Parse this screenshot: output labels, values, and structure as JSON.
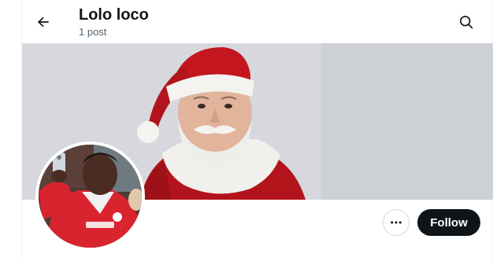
{
  "header": {
    "profile_name": "Lolo loco",
    "post_count": "1 post",
    "back_icon": "arrow-left-icon",
    "search_icon": "search-icon"
  },
  "profile": {
    "banner": "santa-claus-banner-photo",
    "avatar": "footballer-selfie-avatar-photo"
  },
  "actions": {
    "more_icon": "more-horizontal-icon",
    "follow_label": "Follow"
  },
  "colors": {
    "text_primary": "#0f1419",
    "text_secondary": "#536471",
    "follow_bg": "#0f1419",
    "follow_text": "#ffffff",
    "border": "#cfd9de"
  }
}
